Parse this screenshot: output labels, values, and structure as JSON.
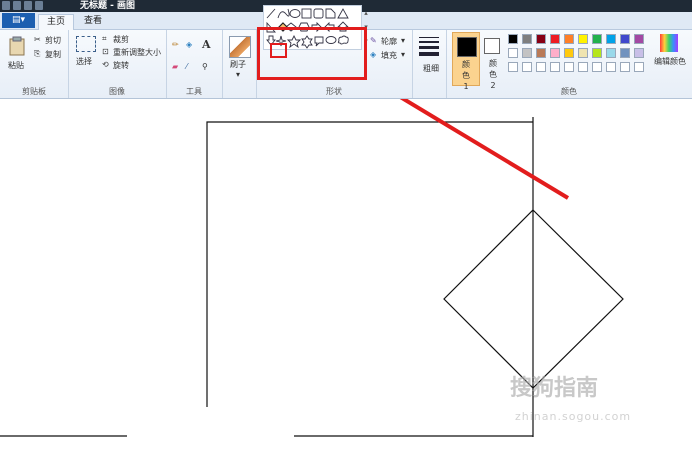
{
  "window": {
    "title": "无标题 - 画图"
  },
  "tabs": {
    "file_label": "▤▾",
    "home": "主页",
    "view": "查看"
  },
  "clipboard": {
    "paste": "粘贴",
    "cut": "剪切",
    "copy": "复制",
    "group": "剪贴板"
  },
  "image": {
    "select": "选择",
    "crop": "裁剪",
    "resize": "重新调整大小",
    "rotate": "旋转",
    "group": "图像"
  },
  "tools": {
    "group": "工具"
  },
  "brushes": {
    "label": "刷子"
  },
  "shapes": {
    "outline": "轮廓",
    "fill": "填充",
    "group": "形状"
  },
  "size": {
    "label": "粗细"
  },
  "colors": {
    "color1": "颜色 1",
    "color2": "颜色 2",
    "edit": "编辑颜色",
    "group": "颜色",
    "palette_row1": [
      "#000000",
      "#7f7f7f",
      "#880015",
      "#ed1c24",
      "#ff7f27",
      "#fff200",
      "#22b14c",
      "#00a2e8",
      "#3f48cc",
      "#a349a4"
    ],
    "palette_row2": [
      "#ffffff",
      "#c3c3c3",
      "#b97a57",
      "#ffaec9",
      "#ffc90e",
      "#efe4b0",
      "#b5e61d",
      "#99d9ea",
      "#7092be",
      "#c8bfe7"
    ]
  },
  "watermark": {
    "text": "搜狗指南",
    "sub": "zhinan.sogou.com"
  }
}
